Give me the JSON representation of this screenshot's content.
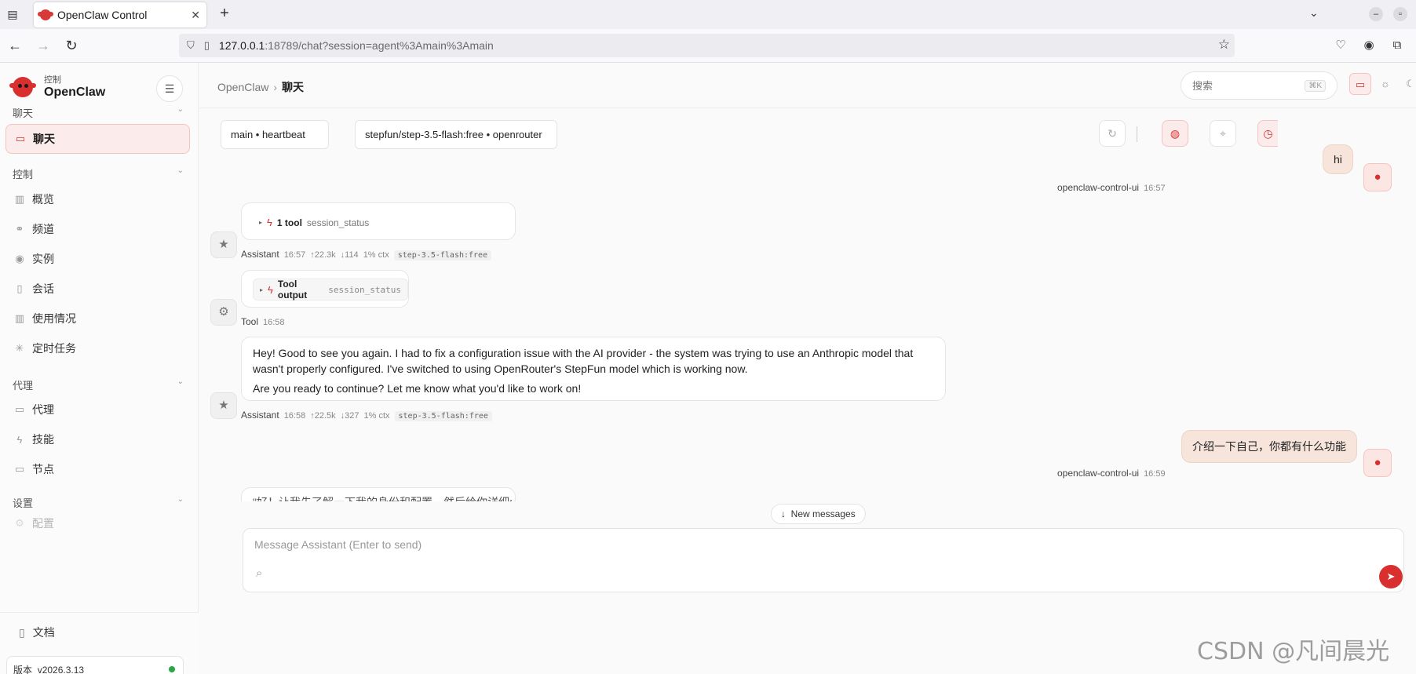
{
  "browser": {
    "tab_title": "OpenClaw Control",
    "url_host": "127.0.0.1",
    "url_rest": ":18789/chat?session=agent%3Amain%3Amain"
  },
  "sidebar": {
    "brand_sub": "控制",
    "brand_name": "OpenClaw",
    "sections": {
      "chat": "聊天",
      "control": "控制",
      "agent": "代理",
      "settings": "设置"
    },
    "items": {
      "chat": "聊天",
      "overview": "概览",
      "channels": "频道",
      "instances": "实例",
      "sessions": "会话",
      "usage": "使用情况",
      "cron": "定时任务",
      "agents": "代理",
      "skills": "技能",
      "nodes": "节点",
      "config": "配置"
    },
    "docs": "文档",
    "version_label": "版本",
    "version_value": "v2026.3.13"
  },
  "topbar": {
    "breadcrumb_root": "OpenClaw",
    "breadcrumb_current": "聊天",
    "search_placeholder": "搜索",
    "search_shortcut": "⌘K"
  },
  "chat": {
    "session_pill": "main • heartbeat",
    "model_pill": "stepfun/step-3.5-flash:free • openrouter",
    "messages": [
      {
        "role": "user",
        "text": "hi",
        "sender": "openclaw-control-ui",
        "time": "16:57"
      },
      {
        "role": "assistant",
        "tool_count": "1 tool",
        "tool_name": "session_status",
        "sender": "Assistant",
        "time": "16:57",
        "up": "↑22.3k",
        "down": "↓114",
        "ctx": "1% ctx",
        "model": "step-3.5-flash:free"
      },
      {
        "role": "tool",
        "tool_label": "Tool output",
        "tool_name": "session_status",
        "sender": "Tool",
        "time": "16:58"
      },
      {
        "role": "assistant",
        "para1": "Hey! Good to see you again. I had to fix a configuration issue with the AI provider - the system was trying to use an Anthropic model that wasn't properly configured. I've switched to using OpenRouter's StepFun model which is working now.",
        "para2": "Are you ready to continue? Let me know what you'd like to work on!",
        "sender": "Assistant",
        "time": "16:58",
        "up": "↑22.5k",
        "down": "↓327",
        "ctx": "1% ctx",
        "model": "step-3.5-flash:free"
      },
      {
        "role": "user",
        "text": "介绍一下自己，你都有什么功能",
        "sender": "openclaw-control-ui",
        "time": "16:59"
      }
    ],
    "partial_text": "\"好！让我先了解一下我的身份和配置，然后给你详细介绍",
    "new_messages": "New messages",
    "composer_placeholder": "Message Assistant (Enter to send)"
  },
  "watermark": "CSDN @凡间晨光",
  "colors": {
    "accent": "#d92f2f",
    "user_bubble": "#f7e5dc"
  }
}
